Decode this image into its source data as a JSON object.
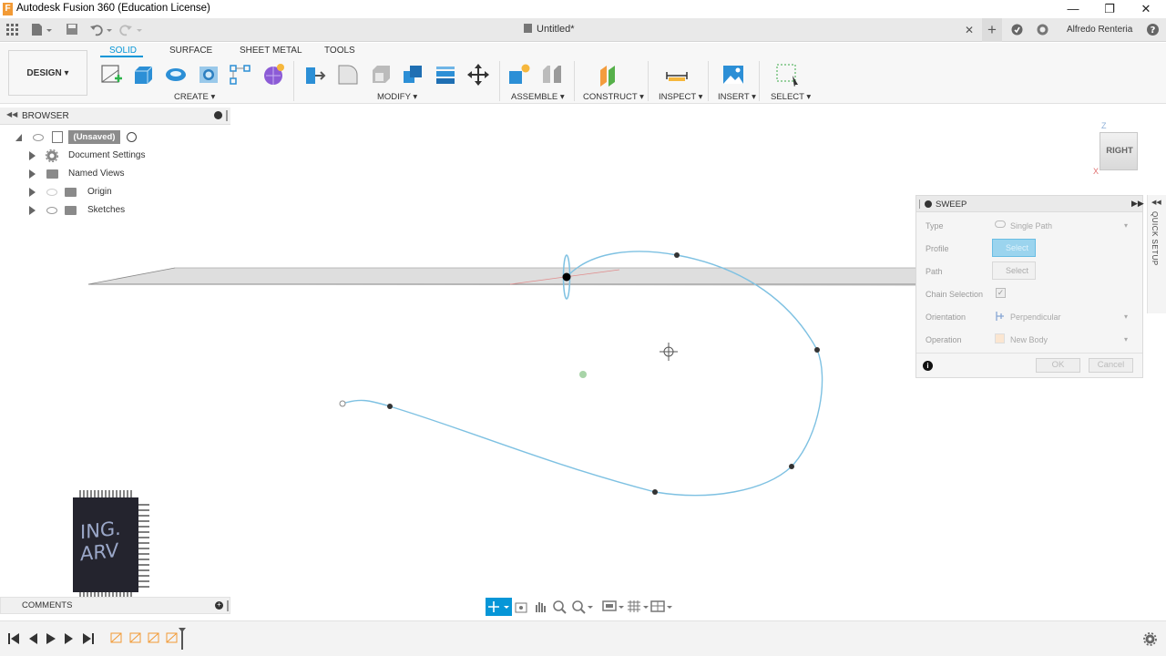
{
  "window": {
    "title": "Autodesk Fusion 360 (Education License)",
    "app_icon_letter": "F",
    "controls": [
      "—",
      "❐",
      "✕"
    ]
  },
  "tabs": {
    "document_title": "Untitled*",
    "user_name": "Alfredo Renteria"
  },
  "ribbon": {
    "workspace": "DESIGN",
    "tabs": [
      "SOLID",
      "SURFACE",
      "SHEET METAL",
      "TOOLS"
    ],
    "active_tab": "SOLID",
    "groups": [
      "CREATE",
      "MODIFY",
      "ASSEMBLE",
      "CONSTRUCT",
      "INSPECT",
      "INSERT",
      "SELECT"
    ]
  },
  "browser": {
    "title": "BROWSER",
    "root": "(Unsaved)",
    "items": [
      "Document Settings",
      "Named Views",
      "Origin",
      "Sketches"
    ]
  },
  "sweep": {
    "title": "SWEEP",
    "rows": [
      {
        "label": "Type",
        "value": "Single Path"
      },
      {
        "label": "Profile",
        "value": "Select"
      },
      {
        "label": "Path",
        "value": "Select"
      },
      {
        "label": "Chain Selection",
        "value": ""
      },
      {
        "label": "Orientation",
        "value": "Perpendicular"
      },
      {
        "label": "Operation",
        "value": "New Body"
      }
    ],
    "ok_label": "OK",
    "cancel_label": "Cancel",
    "quick_setup": "QUICK SETUP"
  },
  "viewcube": {
    "face": "RIGHT",
    "axis_z": "Z",
    "axis_x": "X"
  },
  "comments": {
    "title": "COMMENTS"
  },
  "watermark": {
    "line1": "ING.",
    "line2": "ARV"
  },
  "colors": {
    "accent": "#0696d7",
    "path": "#7ec1e2",
    "panel": "#f5f5f5"
  }
}
